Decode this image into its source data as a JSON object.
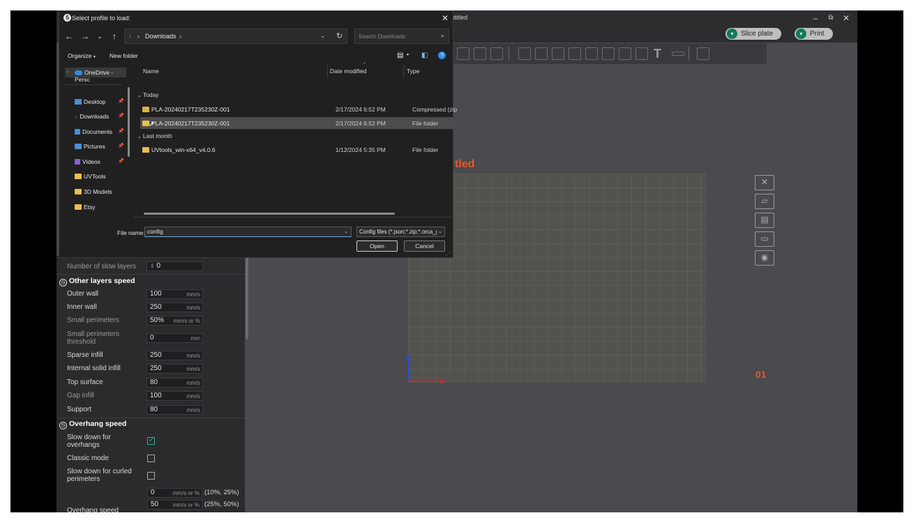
{
  "app": {
    "title": "Untitled",
    "slice_label": "Slice plate",
    "print_label": "Print"
  },
  "plate": {
    "name": "tled",
    "number": "01"
  },
  "dialog": {
    "title": "Select profile to load:",
    "breadcrumb": "Downloads",
    "search_placeholder": "Search Downloads",
    "organize_label": "Organize",
    "new_folder_label": "New folder",
    "nav_items": [
      {
        "label": "OneDrive - Persc",
        "pinned": false
      },
      {
        "label": "Desktop",
        "pinned": true
      },
      {
        "label": "Downloads",
        "pinned": true
      },
      {
        "label": "Documents",
        "pinned": true
      },
      {
        "label": "Pictures",
        "pinned": true
      },
      {
        "label": "Videos",
        "pinned": true
      },
      {
        "label": "UVTools",
        "pinned": false
      },
      {
        "label": "3D Models",
        "pinned": false
      },
      {
        "label": "Etsy",
        "pinned": false
      }
    ],
    "columns": {
      "name": "Name",
      "date": "Date modified",
      "type": "Type"
    },
    "groups": {
      "today": "Today",
      "last_month": "Last month"
    },
    "files": [
      {
        "name": "PLA-20240217T235230Z-001",
        "date": "2/17/2024 6:52 PM",
        "type": "Compressed (zip"
      },
      {
        "name": "PLA-20240217T235230Z-001",
        "date": "2/17/2024 6:52 PM",
        "type": "File folder"
      },
      {
        "name": "UVtools_win-x64_v4.0.6",
        "date": "1/12/2024 5:35 PM",
        "type": "File folder"
      }
    ],
    "file_name_label": "File name:",
    "file_name_value": "config",
    "file_type": "Config files (*.json;*.zip;*.orca_p",
    "open_label": "Open",
    "cancel_label": "Cancel"
  },
  "settings": {
    "slow_layers_label": "Number of slow layers",
    "slow_layers_value": "0",
    "other_speed_title": "Other layers speed",
    "rows": [
      {
        "label": "Outer wall",
        "value": "100",
        "unit": "mm/s"
      },
      {
        "label": "Inner wall",
        "value": "250",
        "unit": "mm/s"
      },
      {
        "label": "Small perimeters",
        "value": "50%",
        "unit": "mm/s or %"
      },
      {
        "label": "Small perimeters threshold",
        "value": "0",
        "unit": "mm"
      },
      {
        "label": "Sparse infill",
        "value": "250",
        "unit": "mm/s"
      },
      {
        "label": "Internal solid infill",
        "value": "250",
        "unit": "mm/s"
      },
      {
        "label": "Top surface",
        "value": "80",
        "unit": "mm/s"
      },
      {
        "label": "Gap infill",
        "value": "100",
        "unit": "mm/s"
      },
      {
        "label": "Support",
        "value": "80",
        "unit": "mm/s"
      }
    ],
    "overhang_title": "Overhang speed",
    "slow_overhangs_label": "Slow down for overhangs",
    "classic_mode_label": "Classic mode",
    "slow_curled_label": "Slow down for curled perimeters",
    "overhang_rows": [
      {
        "value": "0",
        "unit": "mm/s or %",
        "range": "(10%, 25%)"
      },
      {
        "value": "50",
        "unit": "mm/s or %",
        "range": "(25%, 50%)"
      }
    ],
    "overhang_speed_label": "Overhang speed"
  },
  "colors": {
    "accent": "#0f7a5a",
    "plate_label": "#e8572f",
    "checkbox": "#2bb38a"
  }
}
